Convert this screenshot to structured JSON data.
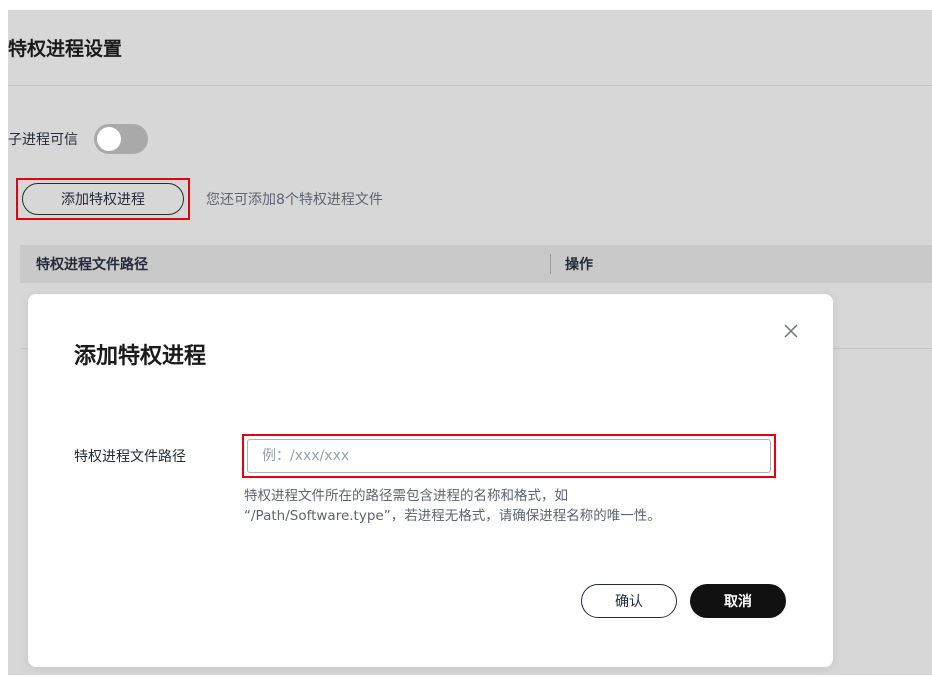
{
  "page": {
    "title": "特权进程设置",
    "toggle_label": "子进程可信",
    "toggle_on": false,
    "add_button_label": "添加特权进程",
    "add_hint": "您还可添加8个特权进程文件",
    "table": {
      "columns": [
        "特权进程文件路径",
        "操作"
      ]
    }
  },
  "dialog": {
    "title": "添加特权进程",
    "field_label": "特权进程文件路径",
    "input_placeholder": "例：/xxx/xxx",
    "input_value": "",
    "help_line1": "特权进程文件所在的路径需包含进程的名称和格式，如",
    "help_line2": "“/Path/Software.type”，若进程无格式，请确保进程名称的唯一性。",
    "confirm_label": "确认",
    "cancel_label": "取消",
    "close_icon": "close-icon"
  },
  "colors": {
    "highlight": "#e60012",
    "overlay": "#d7d7d7",
    "primary_button": "#111111"
  }
}
